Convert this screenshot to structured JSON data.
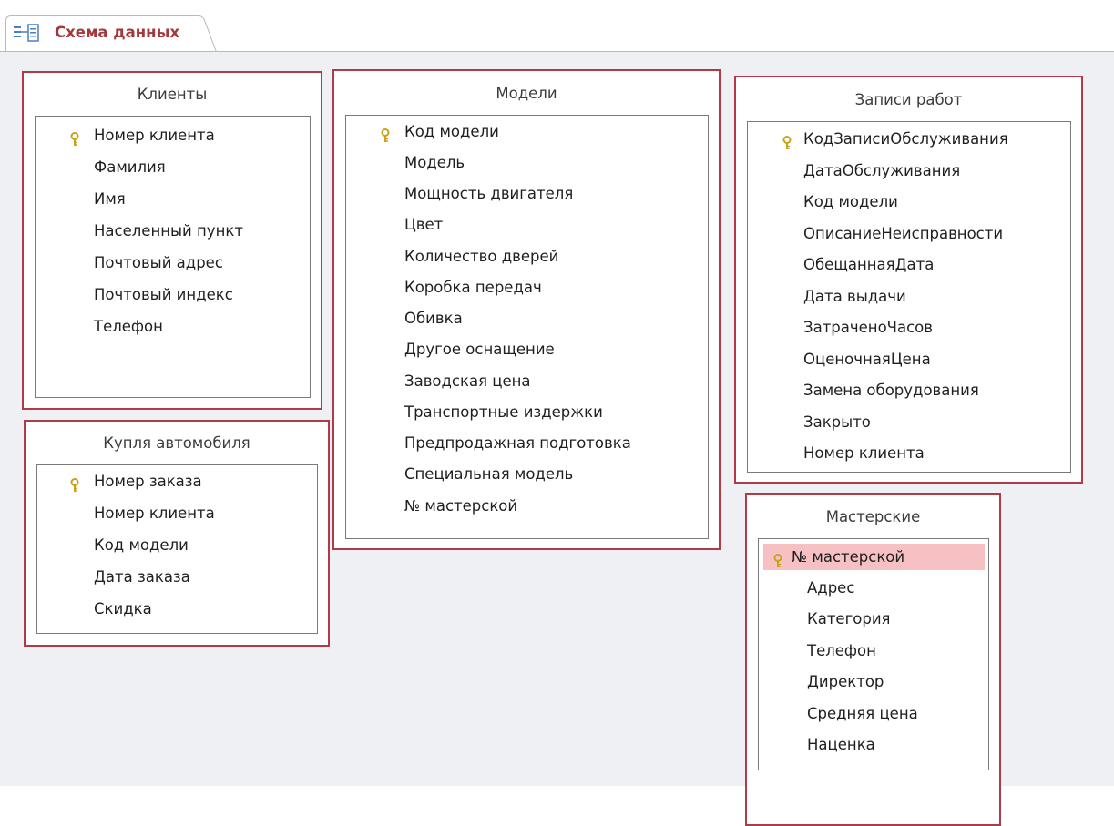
{
  "tab": {
    "icon": "relationships-icon",
    "label": "Схема данных"
  },
  "tables": {
    "clients": {
      "title": "Клиенты",
      "fields": [
        {
          "name": "Номер клиента",
          "key": true
        },
        {
          "name": "Фамилия"
        },
        {
          "name": "Имя"
        },
        {
          "name": "Населенный пункт"
        },
        {
          "name": "Почтовый адрес"
        },
        {
          "name": "Почтовый индекс"
        },
        {
          "name": "Телефон"
        }
      ]
    },
    "purchase": {
      "title": "Купля автомобиля",
      "fields": [
        {
          "name": "Номер заказа",
          "key": true
        },
        {
          "name": "Номер клиента"
        },
        {
          "name": "Код модели"
        },
        {
          "name": "Дата заказа"
        },
        {
          "name": "Скидка"
        }
      ]
    },
    "models": {
      "title": "Модели",
      "fields": [
        {
          "name": "Код модели",
          "key": true
        },
        {
          "name": "Модель"
        },
        {
          "name": "Мощность двигателя"
        },
        {
          "name": "Цвет"
        },
        {
          "name": "Количество дверей"
        },
        {
          "name": "Коробка передач"
        },
        {
          "name": "Обивка"
        },
        {
          "name": "Другое оснащение"
        },
        {
          "name": "Заводская цена"
        },
        {
          "name": "Транспортные издержки"
        },
        {
          "name": "Предпродажная подготовка"
        },
        {
          "name": "Специальная модель"
        },
        {
          "name": "№ мастерской"
        }
      ]
    },
    "work_records": {
      "title": "Записи работ",
      "fields": [
        {
          "name": "КодЗаписиОбслуживания",
          "key": true
        },
        {
          "name": "ДатаОбслуживания"
        },
        {
          "name": "Код модели"
        },
        {
          "name": "ОписаниеНеисправности"
        },
        {
          "name": "ОбещаннаяДата"
        },
        {
          "name": "Дата выдачи"
        },
        {
          "name": "ЗатраченоЧасов"
        },
        {
          "name": "ОценочнаяЦена"
        },
        {
          "name": "Замена оборудования"
        },
        {
          "name": "Закрыто"
        },
        {
          "name": "Номер клиента"
        }
      ]
    },
    "workshops": {
      "title": "Мастерские",
      "fields": [
        {
          "name": "№ мастерской",
          "key": true,
          "selected": true
        },
        {
          "name": "Адрес"
        },
        {
          "name": "Категория"
        },
        {
          "name": "Телефон"
        },
        {
          "name": "Директор"
        },
        {
          "name": "Средняя цена"
        },
        {
          "name": "Наценка"
        }
      ]
    }
  }
}
